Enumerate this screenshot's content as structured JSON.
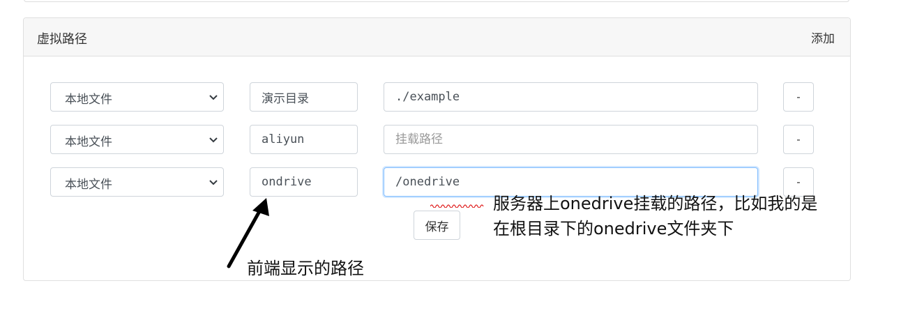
{
  "card": {
    "title": "虚拟路径",
    "add_label": "添加"
  },
  "rows": [
    {
      "storage": "本地文件",
      "name": "演示目录",
      "path": "./example",
      "path_placeholder": "挂载路径",
      "remove_label": "-"
    },
    {
      "storage": "本地文件",
      "name": "aliyun",
      "path": "",
      "path_placeholder": "挂载路径",
      "remove_label": "-"
    },
    {
      "storage": "本地文件",
      "name": "ondrive",
      "path": "/onedrive",
      "path_placeholder": "挂载路径",
      "remove_label": "-"
    }
  ],
  "save_label": "保存",
  "annotations": {
    "server_path_line1": "服务器上onedrive挂载的路径，比如我的是",
    "server_path_line2": "在根目录下的onedrive文件夹下",
    "frontend_path": "前端显示的路径"
  },
  "colors": {
    "header_bg": "#f7f7f7",
    "focus_border": "#80bdff",
    "spellcheck": "#e02020"
  }
}
